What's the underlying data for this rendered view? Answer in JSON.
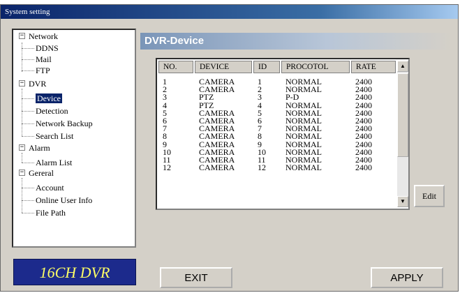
{
  "window": {
    "title": "System setting"
  },
  "tree": {
    "network": {
      "label": "Network",
      "expander": "−",
      "children": [
        "DDNS",
        "Mail",
        "FTP"
      ]
    },
    "dvr": {
      "label": "DVR",
      "expander": "−",
      "children": [
        "Device",
        "Detection",
        "Network Backup",
        "Search List"
      ],
      "selected": "Device"
    },
    "alarm": {
      "label": "Alarm",
      "expander": "−",
      "children": [
        "Alarm List"
      ]
    },
    "general": {
      "label": "Gereral",
      "expander": "−",
      "children": [
        "Account",
        "Online User Info",
        "File Path"
      ]
    }
  },
  "panel": {
    "title": "DVR-Device"
  },
  "table": {
    "headers": [
      "NO.",
      "DEVICE",
      "ID",
      "PROCOTOL",
      "RATE"
    ],
    "rows": [
      [
        "1",
        "CAMERA",
        "1",
        "NORMAL",
        "2400"
      ],
      [
        "2",
        "CAMERA",
        "2",
        "NORMAL",
        "2400"
      ],
      [
        "3",
        "PTZ",
        "3",
        "P-D",
        "2400"
      ],
      [
        "4",
        "PTZ",
        "4",
        "NORMAL",
        "2400"
      ],
      [
        "5",
        "CAMERA",
        "5",
        "NORMAL",
        "2400"
      ],
      [
        "6",
        "CAMERA",
        "6",
        "NORMAL",
        "2400"
      ],
      [
        "7",
        "CAMERA",
        "7",
        "NORMAL",
        "2400"
      ],
      [
        "8",
        "CAMERA",
        "8",
        "NORMAL",
        "2400"
      ],
      [
        "9",
        "CAMERA",
        "9",
        "NORMAL",
        "2400"
      ],
      [
        "10",
        "CAMERA",
        "10",
        "NORMAL",
        "2400"
      ],
      [
        "11",
        "CAMERA",
        "11",
        "NORMAL",
        "2400"
      ],
      [
        "12",
        "CAMERA",
        "12",
        "NORMAL",
        "2400"
      ]
    ]
  },
  "buttons": {
    "edit": "Edit",
    "exit": "EXIT",
    "apply": "APPLY"
  },
  "scroll": {
    "up": "▲",
    "down": "▼"
  },
  "logo": {
    "text": "16CH DVR"
  },
  "colors": {
    "titlebar": "#0a246a",
    "selection": "#0a246a",
    "logo_bg": "#1c2a8c",
    "logo_text": "#ffff66",
    "window_bg": "#d4d0c8"
  }
}
